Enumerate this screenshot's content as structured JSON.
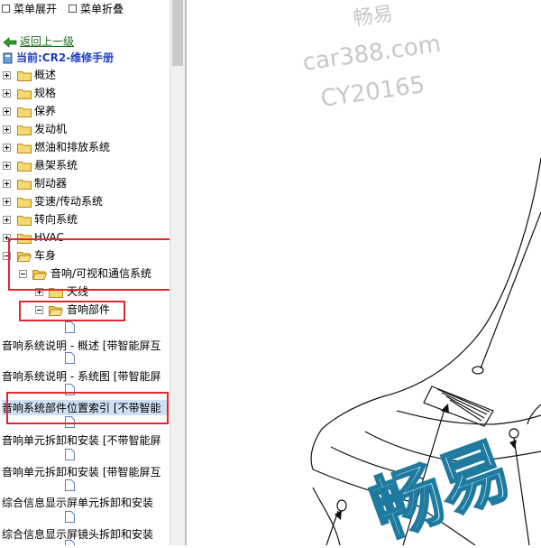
{
  "toolbar": {
    "expand_label": "菜单展开",
    "collapse_label": "菜单折叠"
  },
  "nav": {
    "back_label": "返回上一级",
    "current_label": "当前:CR2-维修手册"
  },
  "tree": {
    "items": [
      {
        "label": "概述"
      },
      {
        "label": "规格"
      },
      {
        "label": "保养"
      },
      {
        "label": "发动机"
      },
      {
        "label": "燃油和排放系统"
      },
      {
        "label": "悬架系统"
      },
      {
        "label": "制动器"
      },
      {
        "label": "变速/传动系统"
      },
      {
        "label": "转向系统"
      },
      {
        "label": "HVAC"
      },
      {
        "label": "车身"
      }
    ],
    "sub1": {
      "label": "音响/可视和通信系统"
    },
    "sub2a": {
      "label": "天线"
    },
    "sub2b": {
      "label": "音响部件"
    },
    "leaves": [
      {
        "label": "音响系统说明 - 概述 [带智能屏互"
      },
      {
        "label": "音响系统说明 - 系统图 [带智能屏"
      },
      {
        "label": "音响系统部件位置索引 [不带智能"
      },
      {
        "label": "音响单元拆卸和安装 [不带智能屏"
      },
      {
        "label": "音响单元拆卸和安装 [带智能屏互"
      },
      {
        "label": "综合信息显示屏单元拆卸和安装"
      },
      {
        "label": "综合信息显示屏镜头拆卸和安装"
      }
    ]
  },
  "watermark": {
    "brand": "畅易",
    "site": "car388.com",
    "code": "CY20165",
    "big": "畅易"
  },
  "colors": {
    "highlight_red": "#e0272f",
    "link_green": "#1a6e1a",
    "current_blue": "#1c3fbf",
    "selected_bg": "#cfe0f5"
  }
}
